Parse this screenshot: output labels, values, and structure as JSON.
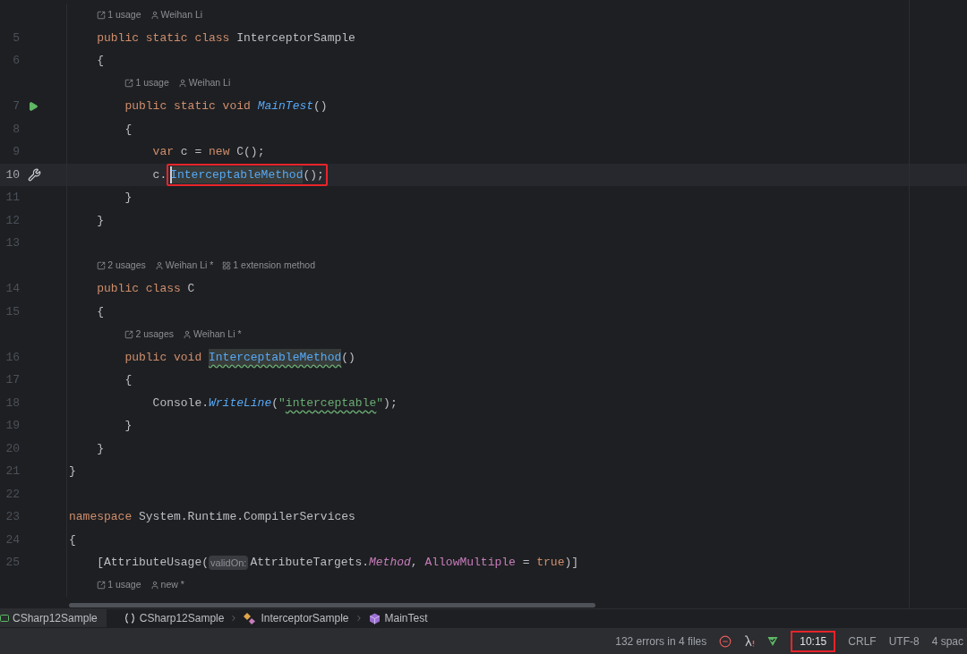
{
  "editor": {
    "lines": [
      {
        "kind": "scope",
        "children": [
          {
            "kind": "hint",
            "items": [
              {
                "kind": "usages",
                "text": "1 usage"
              },
              {
                "kind": "author",
                "text": "Weihan Li"
              }
            ]
          },
          {
            "kind": "code",
            "number": "5",
            "tokens": [
              {
                "text": "public static class ",
                "kind": "keyword"
              },
              {
                "text": "InterceptorSample",
                "kind": "plain"
              }
            ]
          },
          {
            "kind": "code",
            "number": "6",
            "tokens": [
              {
                "text": "{",
                "kind": "plain"
              }
            ],
            "children": [
              {
                "kind": "hint",
                "items": [
                  {
                    "kind": "usages",
                    "text": "1 usage"
                  },
                  {
                    "kind": "author",
                    "text": "Weihan Li"
                  }
                ]
              },
              {
                "kind": "code",
                "number": "7",
                "runnable": true,
                "tokens": [
                  {
                    "text": "public static void ",
                    "kind": "keyword"
                  },
                  {
                    "text": "MainTest",
                    "kind": "method_italic"
                  },
                  {
                    "text": "()",
                    "kind": "plain"
                  }
                ]
              },
              {
                "kind": "code",
                "number": "8",
                "tokens": [
                  {
                    "text": "{",
                    "kind": "plain"
                  }
                ],
                "children": [
                  {
                    "kind": "code",
                    "number": "9",
                    "tokens": [
                      {
                        "text": "var ",
                        "kind": "keyword"
                      },
                      {
                        "text": "c = ",
                        "kind": "plain"
                      },
                      {
                        "text": "new ",
                        "kind": "keyword"
                      },
                      {
                        "text": "C();",
                        "kind": "plain"
                      }
                    ]
                  },
                  {
                    "kind": "code",
                    "number": "10",
                    "current": true,
                    "quick_fix": true,
                    "tokens": [
                      {
                        "text": "c.",
                        "kind": "plain"
                      },
                      {
                        "text": "InterceptableMethod",
                        "kind": "method",
                        "highlighted": true,
                        "caret": true,
                        "boxed": true
                      },
                      {
                        "text": "();",
                        "kind": "plain",
                        "boxed": true
                      }
                    ]
                  }
                ]
              },
              {
                "kind": "code",
                "number": "11",
                "tokens": [
                  {
                    "text": "}",
                    "kind": "plain"
                  }
                ]
              }
            ]
          },
          {
            "kind": "code",
            "number": "12",
            "tokens": [
              {
                "text": "}",
                "kind": "plain"
              }
            ]
          },
          {
            "kind": "code",
            "number": "13"
          },
          {
            "kind": "hint",
            "items": [
              {
                "kind": "usages",
                "text": "2 usages"
              },
              {
                "kind": "author",
                "text": "Weihan Li *"
              },
              {
                "kind": "extension",
                "text": "1 extension method"
              }
            ]
          },
          {
            "kind": "code",
            "number": "14",
            "tokens": [
              {
                "text": "public class ",
                "kind": "keyword"
              },
              {
                "text": "C",
                "kind": "plain"
              }
            ]
          },
          {
            "kind": "code",
            "number": "15",
            "tokens": [
              {
                "text": "{",
                "kind": "plain"
              }
            ],
            "children": [
              {
                "kind": "hint",
                "items": [
                  {
                    "kind": "usages",
                    "text": "2 usages"
                  },
                  {
                    "kind": "author",
                    "text": "Weihan Li *"
                  }
                ]
              },
              {
                "kind": "code",
                "number": "16",
                "tokens": [
                  {
                    "text": "public void ",
                    "kind": "keyword"
                  },
                  {
                    "text": "InterceptableMethod",
                    "kind": "method",
                    "highlighted": true,
                    "squiggle": true
                  },
                  {
                    "text": "()",
                    "kind": "plain"
                  }
                ]
              },
              {
                "kind": "code",
                "number": "17",
                "tokens": [
                  {
                    "text": "{",
                    "kind": "plain"
                  }
                ],
                "children": [
                  {
                    "kind": "code",
                    "number": "18",
                    "tokens": [
                      {
                        "text": "Console.",
                        "kind": "plain"
                      },
                      {
                        "text": "WriteLine",
                        "kind": "method_italic"
                      },
                      {
                        "text": "(",
                        "kind": "plain"
                      },
                      {
                        "text": "\"",
                        "kind": "string"
                      },
                      {
                        "text": "interceptable",
                        "kind": "string",
                        "squiggle": true
                      },
                      {
                        "text": "\"",
                        "kind": "string"
                      },
                      {
                        "text": ");",
                        "kind": "plain"
                      }
                    ]
                  }
                ]
              },
              {
                "kind": "code",
                "number": "19",
                "tokens": [
                  {
                    "text": "}",
                    "kind": "plain"
                  }
                ]
              }
            ]
          },
          {
            "kind": "code",
            "number": "20",
            "tokens": [
              {
                "text": "}",
                "kind": "plain"
              }
            ]
          }
        ]
      },
      {
        "kind": "code",
        "number": "21",
        "tokens": [
          {
            "text": "}",
            "kind": "plain"
          }
        ]
      },
      {
        "kind": "code",
        "number": "22"
      },
      {
        "kind": "code",
        "number": "23",
        "tokens": [
          {
            "text": "namespace ",
            "kind": "keyword"
          },
          {
            "text": "System.Runtime.CompilerServices",
            "kind": "plain"
          }
        ]
      },
      {
        "kind": "code",
        "number": "24",
        "tokens": [
          {
            "text": "{",
            "kind": "plain"
          }
        ],
        "children": [
          {
            "kind": "code",
            "number": "25",
            "tokens": [
              {
                "text": "[AttributeUsage(",
                "kind": "plain"
              },
              {
                "text": "validOn:",
                "kind": "inlay"
              },
              {
                "text": "AttributeTargets.",
                "kind": "plain"
              },
              {
                "text": "Method",
                "kind": "enum_italic"
              },
              {
                "text": ", ",
                "kind": "plain"
              },
              {
                "text": "AllowMultiple",
                "kind": "named"
              },
              {
                "text": " = ",
                "kind": "plain"
              },
              {
                "text": "true",
                "kind": "keyword"
              },
              {
                "text": ")]",
                "kind": "plain"
              }
            ]
          },
          {
            "kind": "hint",
            "items": [
              {
                "kind": "usages",
                "text": "1 usage"
              },
              {
                "kind": "author",
                "text": "new *"
              }
            ]
          }
        ]
      }
    ]
  },
  "breadcrumb": {
    "project": "CSharp12Sample",
    "items": [
      {
        "kind": "namespace",
        "text": "CSharp12Sample"
      },
      {
        "kind": "class",
        "text": "InterceptorSample"
      },
      {
        "kind": "method",
        "text": "MainTest"
      }
    ]
  },
  "status_bar": {
    "problems": "132 errors in 4 files",
    "position": "10:15",
    "line_ending": "CRLF",
    "encoding": "UTF-8",
    "indent": "4 spac"
  }
}
